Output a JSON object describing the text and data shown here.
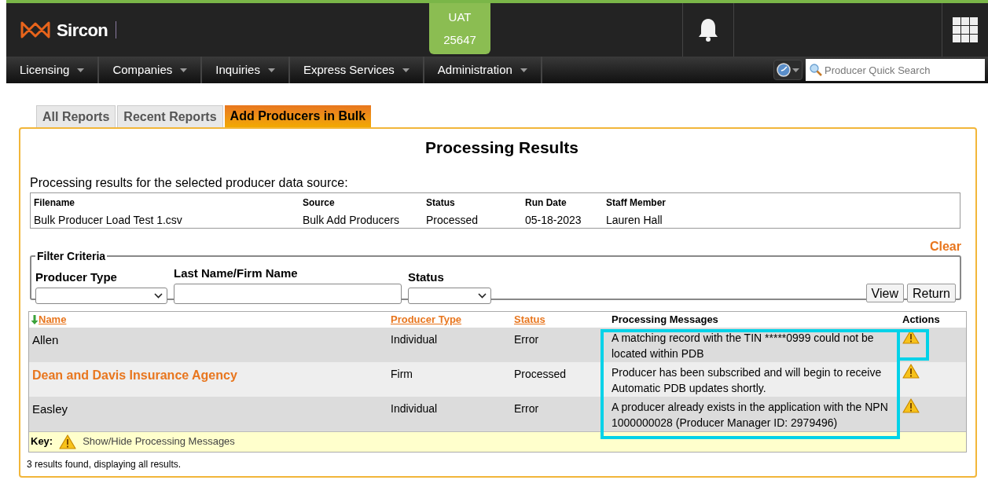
{
  "header": {
    "logo_text": "Sircon",
    "env_badge": {
      "label": "UAT",
      "number": "25647"
    }
  },
  "nav": {
    "menus": [
      {
        "label": "Licensing"
      },
      {
        "label": "Companies"
      },
      {
        "label": "Inquiries"
      },
      {
        "label": "Express Services"
      },
      {
        "label": "Administration"
      }
    ],
    "search": {
      "placeholder": "Producer Quick Search"
    }
  },
  "tabs": [
    {
      "label": "All Reports",
      "selected": false
    },
    {
      "label": "Recent Reports",
      "selected": false
    },
    {
      "label": "Add Producers in Bulk",
      "selected": true
    }
  ],
  "title": "Processing Results",
  "source_intro": "Processing results for the selected producer data source:",
  "source_table": {
    "columns": [
      "Filename",
      "Source",
      "Status",
      "Run Date",
      "Staff Member"
    ],
    "row": [
      "Bulk Producer Load Test 1.csv",
      "Bulk Add Producers",
      "Processed",
      "05-18-2023",
      "Lauren Hall"
    ]
  },
  "clear_link": "Clear",
  "filter": {
    "legend": "Filter Criteria",
    "fields": [
      {
        "label": "Producer Type",
        "kind": "select"
      },
      {
        "label": "Last Name/Firm Name",
        "kind": "text"
      },
      {
        "label": "Status",
        "kind": "select"
      }
    ],
    "buttons": [
      "View",
      "Return"
    ]
  },
  "results": {
    "columns": [
      {
        "label": "Name",
        "kind": "sort"
      },
      {
        "label": "Producer Type",
        "kind": "link"
      },
      {
        "label": "Status",
        "kind": "link"
      },
      {
        "label": "Processing Messages",
        "kind": "plain"
      },
      {
        "label": "Actions",
        "kind": "plain"
      }
    ],
    "rows": [
      {
        "name": "Allen",
        "kind": "plain",
        "type": "Individual",
        "status": "Error",
        "message": "A matching record with the TIN *****0999 could not be located within PDB"
      },
      {
        "name": "Dean and Davis Insurance Agency",
        "kind": "link",
        "type": "Firm",
        "status": "Processed",
        "message": "Producer has been subscribed and will begin to receive Automatic PDB updates shortly."
      },
      {
        "name": "Easley",
        "kind": "plain",
        "type": "Individual",
        "status": "Error",
        "message": "A producer already exists in the application with the NPN 1000000028 (Producer Manager ID: 2979496)"
      }
    ],
    "key": {
      "label": "Key:",
      "text": "Show/Hide Processing Messages"
    },
    "footer": "3 results found, displaying all results."
  }
}
